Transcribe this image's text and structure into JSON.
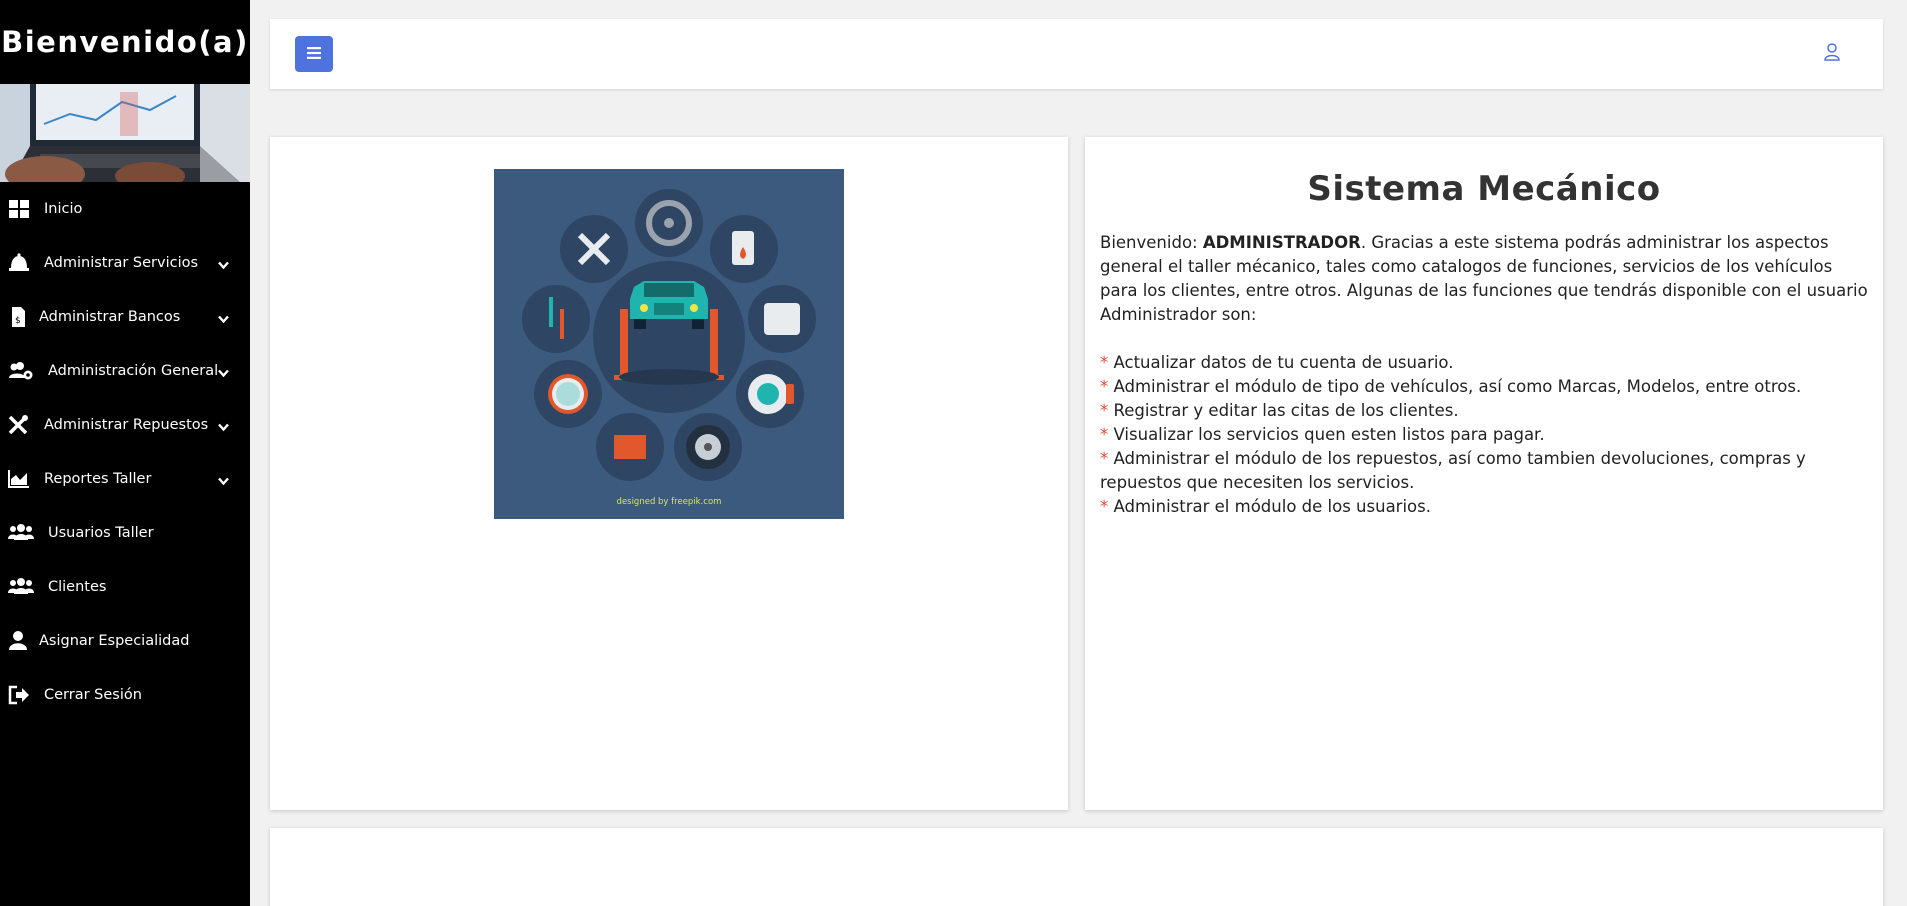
{
  "sidebar": {
    "title": "Bienvenido(a)",
    "items": [
      {
        "label": "Inicio",
        "icon": "dashboard-icon",
        "has_submenu": false
      },
      {
        "label": "Administrar Servicios",
        "icon": "bell-icon",
        "has_submenu": true
      },
      {
        "label": "Administrar Bancos",
        "icon": "invoice-icon",
        "has_submenu": true
      },
      {
        "label": "Administración General",
        "icon": "users-cog-icon",
        "has_submenu": true
      },
      {
        "label": "Administrar Repuestos",
        "icon": "tools-icon",
        "has_submenu": true
      },
      {
        "label": "Reportes Taller",
        "icon": "chart-area-icon",
        "has_submenu": true
      },
      {
        "label": "Usuarios Taller",
        "icon": "users-icon",
        "has_submenu": false
      },
      {
        "label": "Clientes",
        "icon": "users-icon",
        "has_submenu": false
      },
      {
        "label": "Asignar Especialidad",
        "icon": "user-icon",
        "has_submenu": false
      },
      {
        "label": "Cerrar Sesión",
        "icon": "sign-out-icon",
        "has_submenu": false
      }
    ]
  },
  "topbar": {
    "menu_icon": "bars-icon",
    "user_icon": "user-outline-icon",
    "accent_color": "#4e73df"
  },
  "illustration": {
    "credit": "designed by freepik.com"
  },
  "info": {
    "title": "Sistema Mecánico",
    "intro_prefix": "Bienvenido: ",
    "intro_user": "ADMINISTRADOR",
    "intro_suffix": ". Gracias a este sistema podrás administrar los aspectos general el taller mécanico, tales como catalogos de funciones, servicios de los vehículos para los clientes, entre otros. Algunas de las funciones que tendrás disponible con el usuario Administrador son:",
    "bullets": [
      "Actualizar datos de tu cuenta de usuario.",
      "Administrar el módulo de tipo de vehículos, así como Marcas, Modelos, entre otros.",
      "Registrar y editar las citas de los clientes.",
      "Visualizar los servicios quen esten listos para pagar.",
      "Administrar el módulo de los repuestos, así como tambien devoluciones, compras y repuestos que necesiten los servicios.",
      "Administrar el módulo de los usuarios."
    ],
    "bullet_mark": "*",
    "bullet_color": "#e74a3b"
  }
}
